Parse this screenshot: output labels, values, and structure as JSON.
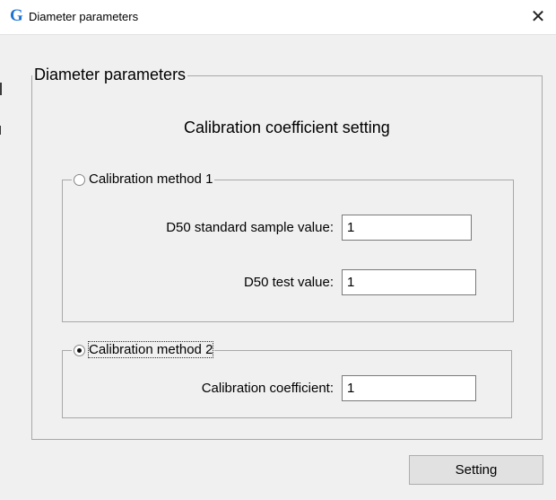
{
  "window": {
    "title": "Diameter parameters",
    "icon": "app-logo-icon",
    "close_glyph": "✕"
  },
  "main_group": {
    "legend": "Diameter parameters",
    "heading": "Calibration coefficient setting"
  },
  "method1": {
    "label": "Calibration method 1",
    "selected": false,
    "fields": [
      {
        "label": "D50 standard sample value:",
        "value": "1"
      },
      {
        "label": "D50 test value:",
        "value": "1"
      }
    ]
  },
  "method2": {
    "label": "Calibration method 2",
    "selected": true,
    "fields": [
      {
        "label": "Calibration coefficient:",
        "value": "1"
      }
    ]
  },
  "buttons": {
    "setting": "Setting"
  },
  "colors": {
    "accent": "#1e73d2",
    "background": "#f0f0f0"
  }
}
